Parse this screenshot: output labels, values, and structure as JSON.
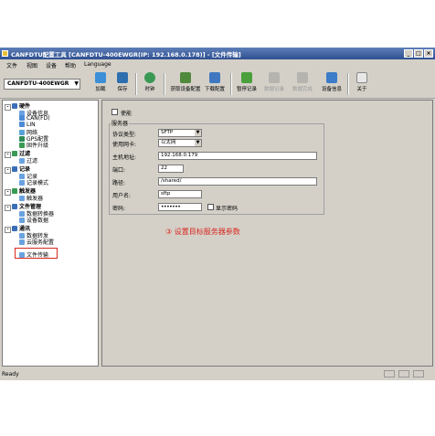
{
  "window": {
    "title": "CANFDTU配置工具 [CANFDTU-400EWGR(IP: 192.168.0.178)] - [文件传输]"
  },
  "menu": [
    "文件",
    "视图",
    "设备",
    "帮助",
    "Language"
  ],
  "device_selector": {
    "value": "CANFDTU-400EWGR"
  },
  "toolbar": [
    {
      "label": "加载",
      "icon": "folder-open-icon",
      "enabled": true
    },
    {
      "label": "保存",
      "icon": "save-icon",
      "enabled": true
    },
    {
      "label": "时钟",
      "icon": "clock-icon",
      "enabled": true
    },
    {
      "label": "获取设备配置",
      "icon": "download-config-icon",
      "enabled": true
    },
    {
      "label": "下载配置",
      "icon": "upload-config-icon",
      "enabled": true
    },
    {
      "label": "暂停记录",
      "icon": "pause-icon",
      "enabled": true
    },
    {
      "label": "数据记录",
      "icon": "record-icon",
      "enabled": false
    },
    {
      "label": "数据完成",
      "icon": "record-done-icon",
      "enabled": false
    },
    {
      "label": "设备信息",
      "icon": "info-icon",
      "enabled": true
    },
    {
      "label": "关于",
      "icon": "about-icon",
      "enabled": true
    }
  ],
  "tree": {
    "groups": [
      {
        "label": "硬件",
        "items": [
          "设备信息",
          "CAN(FD)",
          "LIN",
          "网络",
          "GPS配置",
          "固件升级"
        ]
      },
      {
        "label": "过滤",
        "items": [
          "过滤"
        ]
      },
      {
        "label": "记录",
        "items": [
          "记录",
          "记录模式"
        ]
      },
      {
        "label": "触发器",
        "items": [
          "触发器"
        ]
      },
      {
        "label": "文件管理",
        "items": [
          "数据转换器",
          "设备数据"
        ]
      },
      {
        "label": "通讯",
        "items": [
          "数据转发",
          "云服务配置",
          "文件传输"
        ]
      }
    ],
    "selected": "文件传输"
  },
  "form": {
    "enable_label": "使能",
    "group_label": "服务器",
    "protocol_label": "协议类型:",
    "protocol_value": "SFTP",
    "nic_label": "使用网卡:",
    "nic_value": "以太网",
    "host_label": "主机地址:",
    "host_value": "192.168.0.179",
    "port_label": "端口:",
    "port_value": "22",
    "path_label": "路径:",
    "path_value": "/shared/",
    "user_label": "用户名:",
    "user_value": "sftp",
    "password_label": "密码:",
    "password_value": "•••••••",
    "show_password_label": "显示密码"
  },
  "annotation": "③ 设置目标服务器参数",
  "status": {
    "text": "Ready"
  },
  "colors": {
    "title_bar": "#2e4f90",
    "highlight": "#d9271e",
    "window_bg": "#d4d0c8"
  }
}
